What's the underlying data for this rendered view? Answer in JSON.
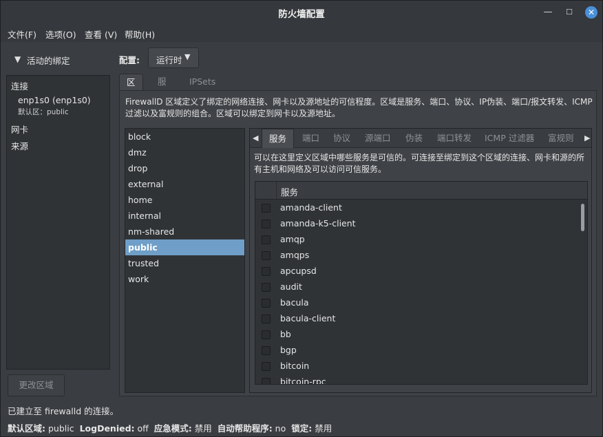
{
  "window": {
    "title": "防火墙配置"
  },
  "menubar": [
    "文件(F)",
    "选项(O)",
    "查看 (V)",
    "帮助(H)"
  ],
  "bindings": {
    "header": "活动的绑定",
    "connections_label": "连接",
    "connection_name": "enp1s0 (enp1s0)",
    "connection_default": "默认区：public",
    "interfaces_label": "网卡",
    "sources_label": "来源",
    "change_zone_button": "更改区域"
  },
  "config": {
    "label": "配置:",
    "value": "运行时"
  },
  "top_tabs": [
    "区域",
    "服务",
    "IPSets"
  ],
  "zones": {
    "description": "FirewallD 区域定义了绑定的网络连接、网卡以及源地址的可信程度。区域是服务、端口、协议、IP伪装、端口/报文转发、ICMP过滤以及富规则的组合。区域可以绑定到网卡以及源地址。",
    "list": [
      "block",
      "dmz",
      "drop",
      "external",
      "home",
      "internal",
      "nm-shared",
      "public",
      "trusted",
      "work"
    ],
    "selected": "public"
  },
  "zone_tabs": [
    "服务",
    "端口",
    "协议",
    "源端口",
    "伪装",
    "端口转发",
    "ICMP 过滤器",
    "富规则"
  ],
  "services": {
    "description": "可以在这里定义区域中哪些服务是可信的。可连接至绑定到这个区域的连接、网卡和源的所有主机和网络及可以访问可信服务。",
    "column_header": "服务",
    "items": [
      "amanda-client",
      "amanda-k5-client",
      "amqp",
      "amqps",
      "apcupsd",
      "audit",
      "bacula",
      "bacula-client",
      "bb",
      "bgp",
      "bitcoin",
      "bitcoin-rpc"
    ]
  },
  "status": {
    "connection": "已建立至 firewalld 的连接。",
    "default_zone_label": "默认区域:",
    "default_zone_value": "public",
    "log_denied_label": "LogDenied:",
    "log_denied_value": "off",
    "panic_label": "应急模式:",
    "panic_value": "禁用",
    "helper_label": "自动帮助程序:",
    "helper_value": "no",
    "lockdown_label": "锁定:",
    "lockdown_value": "禁用"
  },
  "colors": {
    "selection": "#6f9fc8",
    "close_button": "#4a90d9",
    "background": "#3a3d41"
  }
}
